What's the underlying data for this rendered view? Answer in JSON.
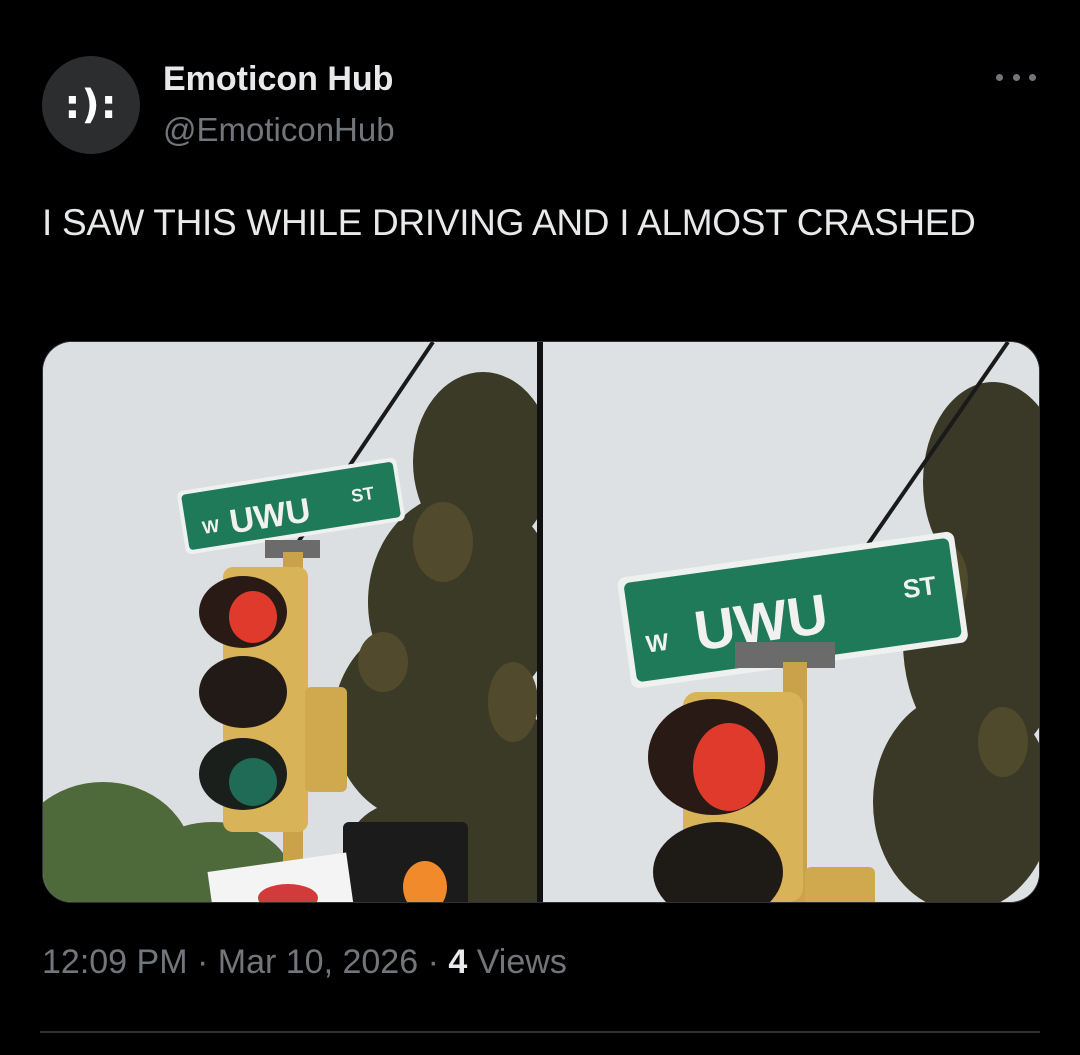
{
  "account": {
    "display_name": "Emoticon Hub",
    "handle": "@EmoticonHub",
    "avatar_text": ":):"
  },
  "tweet": {
    "text": "I SAW THIS WHILE DRIVING AND I ALMOST CRASHED",
    "time": "12:09 PM",
    "date": "Mar 10, 2026",
    "separator": "·",
    "views_count": "4",
    "views_label": "Views"
  },
  "media": {
    "photos": [
      {
        "sign_prefix": "W",
        "sign_name": "UWU",
        "sign_suffix": "ST"
      },
      {
        "sign_prefix": "W",
        "sign_name": "UWU",
        "sign_suffix": "ST"
      }
    ]
  },
  "icons": {
    "more": "more-horizontal-icon"
  },
  "colors": {
    "background": "#000000",
    "text_primary": "#e7e9ea",
    "text_secondary": "#71767b",
    "sign_green": "#1f7a5a",
    "signal_red": "#e03a2c"
  }
}
